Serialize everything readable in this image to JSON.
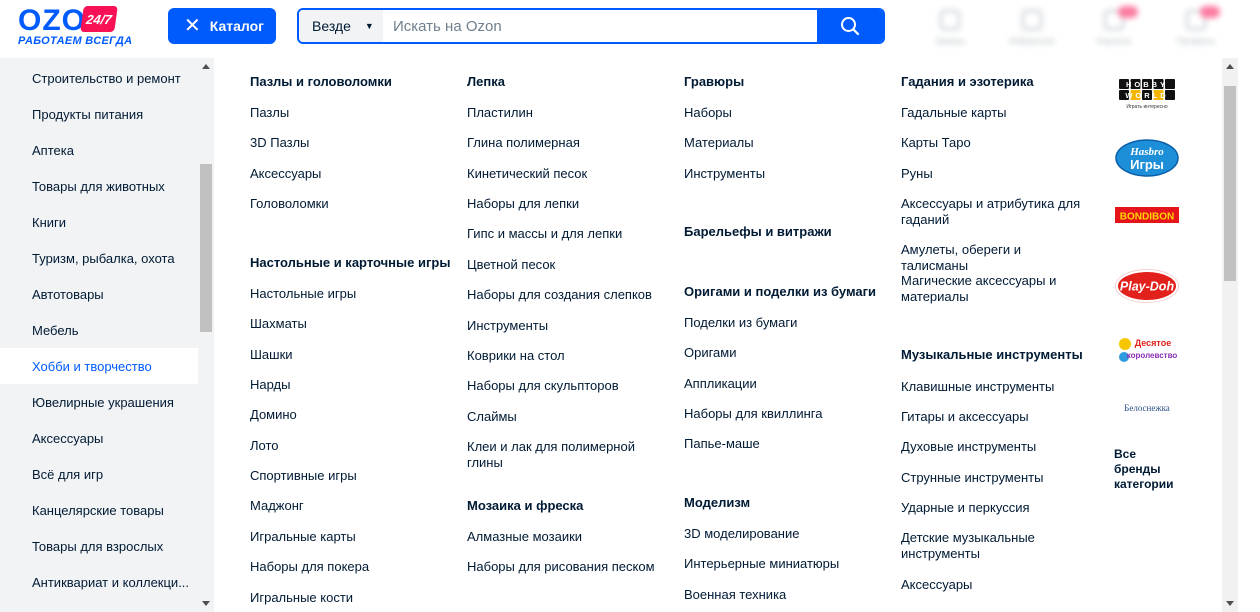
{
  "header": {
    "logo_text": "OZON",
    "logo_badge": "24/7",
    "logo_tagline": "РАБОТАЕМ ВСЕГДА",
    "catalog_label": "Каталог",
    "search": {
      "scope": "Везде",
      "placeholder": "Искать на Ozon"
    },
    "icons": [
      {
        "name": "orders-icon",
        "label": "Заказы"
      },
      {
        "name": "favorites-icon",
        "label": "Избранное"
      },
      {
        "name": "cart-icon",
        "label": "Корзина"
      },
      {
        "name": "profile-icon",
        "label": "Профиль"
      }
    ]
  },
  "sidebar": {
    "items": [
      "Строительство и ремонт",
      "Продукты питания",
      "Аптека",
      "Товары для животных",
      "Книги",
      "Туризм, рыбалка, охота",
      "Автотовары",
      "Мебель",
      "Хобби и творчество",
      "Ювелирные украшения",
      "Аксессуары",
      "Всё для игр",
      "Канцелярские товары",
      "Товары для взрослых",
      "Антиквариат и коллекци..."
    ],
    "active": "Хобби и творчество"
  },
  "columns": [
    {
      "groups": [
        {
          "title": "Пазлы и головоломки",
          "items": [
            "Пазлы",
            "3D Пазлы",
            "Аксессуары",
            "Головоломки"
          ]
        },
        {
          "title": "Настольные и карточные игры",
          "items": [
            "Настольные игры",
            "Шахматы",
            "Шашки",
            "Нарды",
            "Домино",
            "Лото",
            "Спортивные игры",
            "Маджонг",
            "Игральные карты",
            "Наборы для покера",
            "Игральные кости"
          ]
        }
      ]
    },
    {
      "groups": [
        {
          "title": "Лепка",
          "items": [
            "Пластилин",
            "Глина полимерная",
            "Кинетический песок",
            "Наборы для лепки",
            "Гипс и массы и для лепки",
            "Цветной песок",
            "Наборы для создания слепков",
            "Инструменты",
            "Коврики на стол",
            "Наборы для скульпторов",
            "Слаймы",
            "Клеи и лак для полимерной глины"
          ]
        },
        {
          "title": "Мозаика и фреска",
          "items": [
            "Алмазные мозаики",
            "Наборы для рисования песком"
          ]
        }
      ]
    },
    {
      "groups": [
        {
          "title": "Гравюры",
          "items": [
            "Наборы",
            "Материалы",
            "Инструменты"
          ]
        },
        {
          "title": "Барельефы и витражи",
          "items": []
        },
        {
          "title": "Оригами и поделки из бумаги",
          "items": [
            "Поделки из бумаги",
            "Оригами",
            "Аппликации",
            "Наборы для квиллинга",
            "Папье-маше"
          ]
        },
        {
          "title": "Моделизм",
          "items": [
            "3D моделирование",
            "Интерьерные миниатюры",
            "Военная техника"
          ]
        }
      ]
    },
    {
      "groups": [
        {
          "title": "Гадания и эзотерика",
          "items": [
            "Гадальные карты",
            "Карты Таро",
            "Руны",
            "Аксессуары и атрибутика для гаданий",
            "Амулеты, обереги и талисманы",
            "Магические аксессуары и материалы"
          ]
        },
        {
          "title": "Музыкальные инструменты",
          "items": [
            "Клавишные инструменты",
            "Гитары и аксессуары",
            "Духовые инструменты",
            "Струнные инструменты",
            "Ударные и перкуссия",
            "Детские музыкальные инструменты",
            "Аксессуары"
          ]
        }
      ]
    }
  ],
  "brands": [
    {
      "name": "hobby-world-logo",
      "text": "HOBBY WORLD",
      "sub": "Играть интересно"
    },
    {
      "name": "hasbro-games-logo",
      "text": "Hasbro",
      "sub": "Игры"
    },
    {
      "name": "bondibon-logo",
      "text": "BONDIBON"
    },
    {
      "name": "play-doh-logo",
      "text": "Play-Doh"
    },
    {
      "name": "desyatoe-korolevstvo-logo",
      "text": "Десятое королевство"
    },
    {
      "name": "belosnezhka-logo",
      "text": "Белоснежка"
    }
  ],
  "all_brands_label": "Все бренды категории",
  "colors": {
    "accent": "#005bff",
    "badge": "#f91155",
    "sidebar_bg": "#f2f3f5",
    "text": "#001a34"
  }
}
